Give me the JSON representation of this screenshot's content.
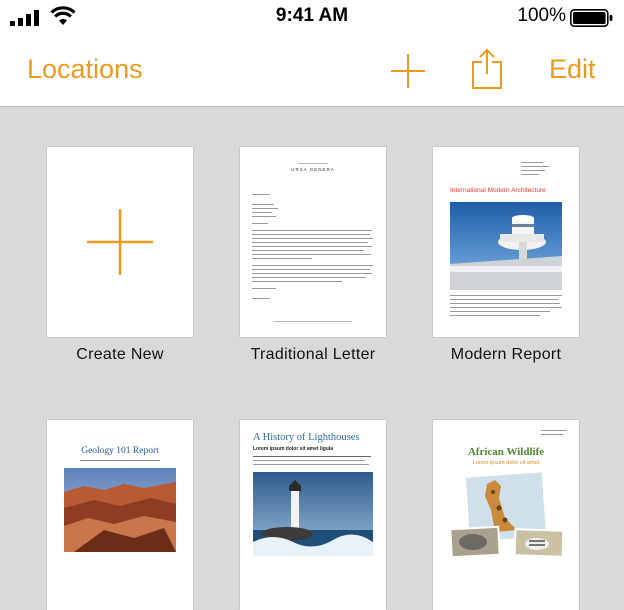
{
  "status_bar": {
    "time": "9:41 AM",
    "battery": "100%",
    "icons": [
      "signal-icon",
      "wifi-icon",
      "battery-icon"
    ]
  },
  "nav": {
    "back_label": "Locations",
    "edit_label": "Edit",
    "accent_color": "#ec9a1e",
    "icons": [
      "plus-icon",
      "share-icon"
    ]
  },
  "templates": [
    {
      "label": "Create New"
    },
    {
      "label": "Traditional Letter",
      "preview": {
        "name": "URSA GENERA"
      }
    },
    {
      "label": "Modern Report",
      "preview": {
        "headline": "International Modern Architecture"
      }
    },
    {
      "label": "",
      "preview": {
        "title": "Geology 101 Report"
      }
    },
    {
      "label": "",
      "preview": {
        "title": "A History of Lighthouses",
        "subtitle": "Lorem ipsum dolor sit amet ligula"
      }
    },
    {
      "label": "",
      "preview": {
        "title": "African Wildlife",
        "subtitle": "Lorem ipsum dolor sit amet"
      }
    }
  ]
}
